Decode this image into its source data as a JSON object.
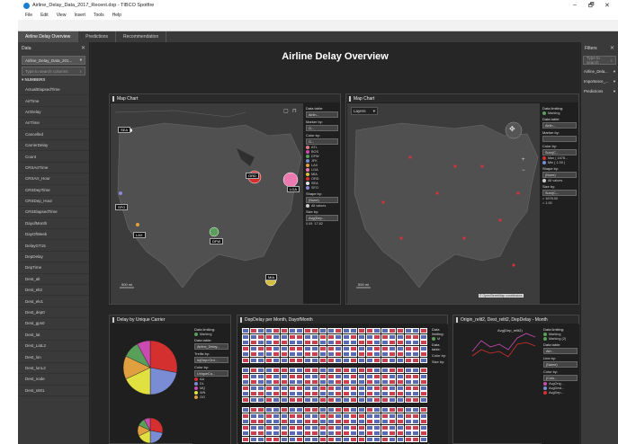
{
  "window": {
    "title": "Airline_Delay_Data_2017_Recent.dxp - TIBCO Spotfire",
    "controls": [
      "–",
      "🗗",
      "✕"
    ]
  },
  "menu": [
    "File",
    "Edit",
    "View",
    "Insert",
    "Tools",
    "Help"
  ],
  "tabs": [
    {
      "label": "Airline Delay Overview",
      "active": true
    },
    {
      "label": "Predictions",
      "active": false
    },
    {
      "label": "Recommendation",
      "active": false
    }
  ],
  "left_panel": {
    "title": "Data",
    "table_dropdown": "Airline_Delay_Data_201...",
    "search_placeholder": "Type to search columns",
    "section_label": "NUMBERS",
    "columns": [
      "ActualElapsedTime",
      "AirTime",
      "ArrDelay",
      "ArrTime",
      "Cancelled",
      "CarrierDelay",
      "Count",
      "CRSArrTime",
      "CRSArr_Hour",
      "CRSDepTime",
      "CRSDep_Hour",
      "CRSElapsedTime",
      "DayofMonth",
      "DayOfWeek",
      "DelayGT15",
      "DepDelay",
      "DepTime",
      "Dest_alt",
      "Dest_elt2",
      "Dest_elv1",
      "Dest_dep0",
      "Dest_gps0",
      "Dest_lat",
      "Dest_LatL2",
      "Dest_lon",
      "Dest_lonL2",
      "Dest_node",
      "Dest_s001"
    ]
  },
  "right_panel": {
    "title": "Filters",
    "search_placeholder": "Type to search",
    "items": [
      "Airline_Dela...",
      "Importance_...",
      "Predictions"
    ]
  },
  "page_title": "Airline Delay Overview",
  "map_left": {
    "title": "Map Chart",
    "legend": {
      "data_table_label": "Data table:",
      "data_table_value": "Airlin...",
      "marker_by_label": "Marker by:",
      "marker_by_value": "O...",
      "color_by_label": "Color by:",
      "color_by_value": "O...",
      "items": [
        {
          "label": "ATL",
          "color": "#e07a86"
        },
        {
          "label": "BOS",
          "color": "#c94bb0"
        },
        {
          "label": "DFW",
          "color": "#58a05a"
        },
        {
          "label": "JFK",
          "color": "#7a8cd4"
        },
        {
          "label": "LAX",
          "color": "#e0a040"
        },
        {
          "label": "LGA",
          "color": "#ea7ab0"
        },
        {
          "label": "MIA",
          "color": "#d4c040"
        },
        {
          "label": "ORD",
          "color": "#d43030"
        },
        {
          "label": "SEA",
          "color": "#e8e8e8"
        },
        {
          "label": "SFO",
          "color": "#8a8ad8"
        }
      ],
      "shape_by_label": "Shape by:",
      "shape_by_value": "(None)",
      "all_values": "All values",
      "size_by_label": "Size by:",
      "size_by_value": "Avg(Dep...",
      "size_min": "0.09",
      "size_max": "17.82"
    },
    "airports": [
      {
        "code": "SEA"
      },
      {
        "code": "SFO"
      },
      {
        "code": "LAX"
      },
      {
        "code": "DFW"
      },
      {
        "code": "ORD"
      },
      {
        "code": "LGA"
      },
      {
        "code": "MIA"
      }
    ],
    "scale": "500 mi"
  },
  "map_right": {
    "title": "Map Chart",
    "layers_label": "Layers",
    "legend": {
      "data_limiting": "Data limiting:",
      "marking": "Marking",
      "data_table_label": "Data table:",
      "data_table_value": "Airlin...",
      "marker_by_label": "Marker by:",
      "color_by_label": "Color by:",
      "color_by_value": "Sum(C...",
      "items": [
        {
          "label": "Max ( 1678...",
          "color": "#d43030"
        },
        {
          "label": "Min ( 1.00 )",
          "color": "#7a8cd4"
        }
      ],
      "shape_by_label": "Shape by:",
      "shape_by_value": "(None)",
      "all_values": "All values",
      "size_by_label": "Size by:",
      "size_by_value": "Sum(C...",
      "size_max": "= 1678.00",
      "size_min": "= 1.00"
    },
    "scale": "500 mi",
    "attribution": "© OpenStreetMap contributors"
  },
  "pie": {
    "title": "Delay by Unique Carrier",
    "legend": {
      "data_limiting": "Data limiting:",
      "marking": "Marking",
      "data_table_label": "Data table:",
      "data_table_value": "Airline_Delay...",
      "trellis_label": "Trellis by:",
      "trellis_value": "Is(Dep>Ord...",
      "color_by_label": "Color by:",
      "color_by_value": "UniqueCa...",
      "items": [
        {
          "label": "AA",
          "color": "#d43030"
        },
        {
          "label": "DL",
          "color": "#7a8cd4"
        },
        {
          "label": "MQ",
          "color": "#c94bb0"
        },
        {
          "label": "WN",
          "color": "#e0e040"
        },
        {
          "label": "OO",
          "color": "#d4a040"
        }
      ]
    },
    "slices": [
      0.28,
      0.22,
      0.18,
      0.14,
      0.1,
      0.08
    ],
    "slice_colors": [
      "#d43030",
      "#7a8cd4",
      "#e0e040",
      "#e0a040",
      "#58a05a",
      "#c94bb0"
    ]
  },
  "heatmap": {
    "title": "DepDelay per Month, DayofMonth",
    "legend": {
      "data_limiting": "Data limiting:",
      "m": "M",
      "data_table_label": "Data table:",
      "color_label": "Color by:",
      "size_label": "Size by:"
    },
    "y_ticks": [
      "70",
      "60",
      "50",
      "40",
      "30",
      "20",
      "10"
    ]
  },
  "line": {
    "title": "Origin_relit2, Dest_relit2, DepDelay - Month",
    "annotation": "Avg(Dep_relit2)",
    "legend": {
      "data_limiting": "Data limiting:",
      "marking": "Marking",
      "marking2": "Marking (2)",
      "data_table_label": "Data table:",
      "data_table_value": "Airl...",
      "line_by_label": "Line by:",
      "line_by_value": "(Name)",
      "color_by_label": "Color by:",
      "color_by_value": "(Colu...",
      "items": [
        {
          "label": "AvgOrig...",
          "color": "#c94bb0"
        },
        {
          "label": "AvgDest...",
          "color": "#7a8cd4"
        },
        {
          "label": "AvgDep...",
          "color": "#d43030"
        }
      ]
    },
    "y_ticks": [
      "70",
      "60",
      "50",
      "40",
      "30",
      "20",
      "10"
    ]
  }
}
